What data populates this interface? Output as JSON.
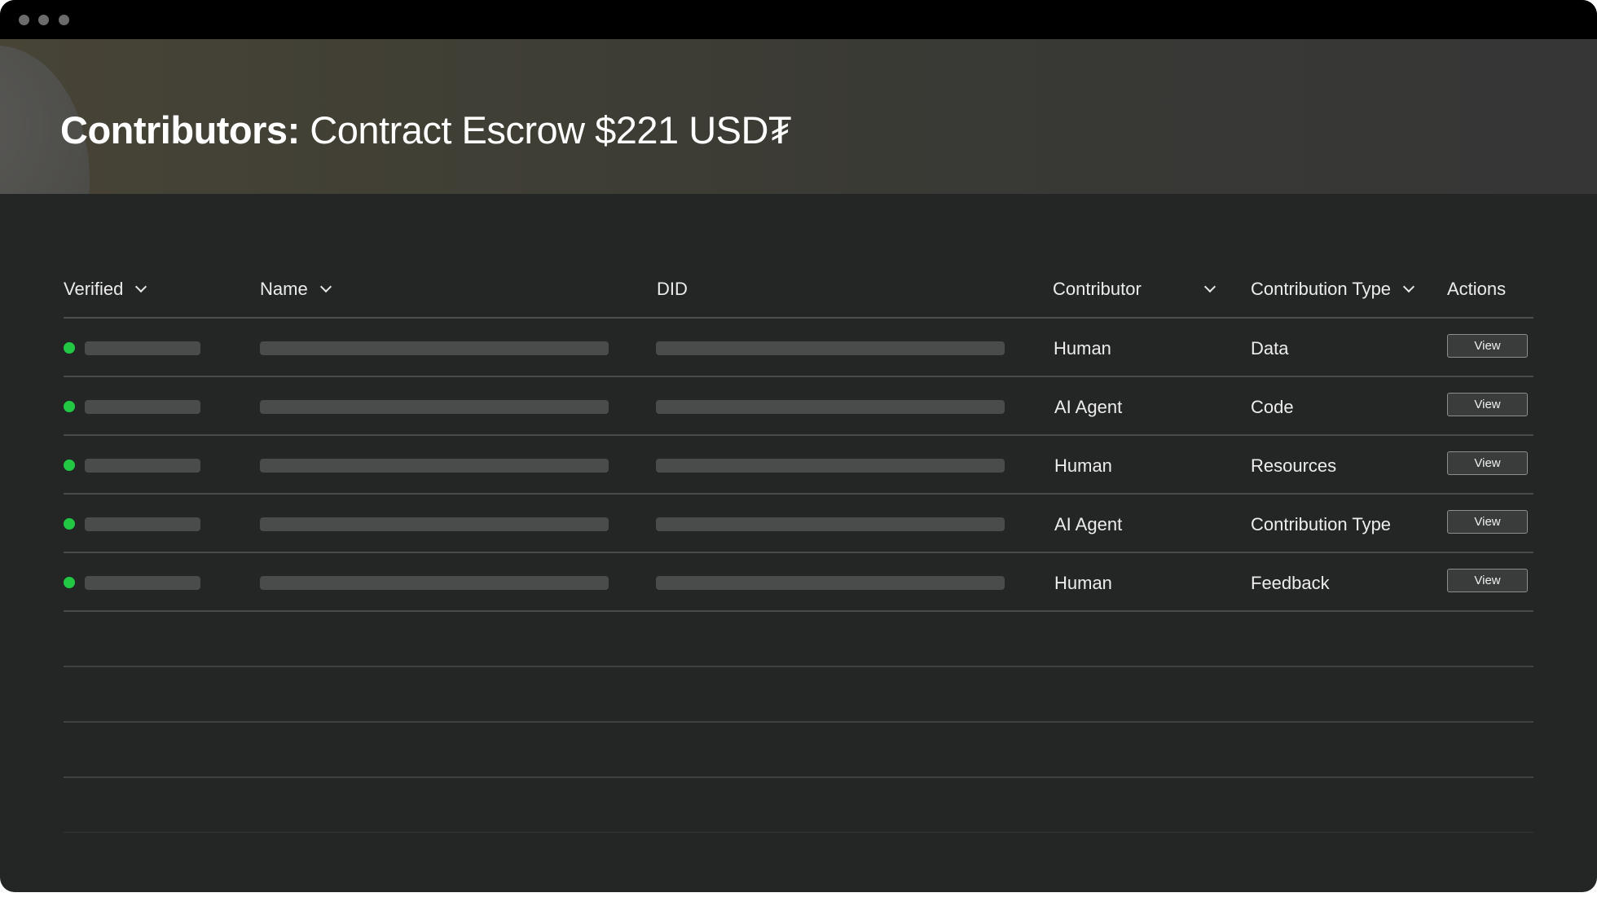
{
  "header": {
    "title_bold": "Contributors:",
    "title_rest": "Contract Escrow $221 USD₮"
  },
  "table": {
    "columns": [
      {
        "label": "Verified",
        "sortable": true
      },
      {
        "label": "Name",
        "sortable": true
      },
      {
        "label": "DID",
        "sortable": false
      },
      {
        "label": "Contributor",
        "sortable": true
      },
      {
        "label": "Contribution Type",
        "sortable": true
      },
      {
        "label": "Actions",
        "sortable": false
      }
    ],
    "rows": [
      {
        "verified": true,
        "contributor": "Human",
        "contribution_type": "Data",
        "action": "View"
      },
      {
        "verified": true,
        "contributor": "AI Agent",
        "contribution_type": "Code",
        "action": "View"
      },
      {
        "verified": true,
        "contributor": "Human",
        "contribution_type": "Resources",
        "action": "View"
      },
      {
        "verified": true,
        "contributor": "AI Agent",
        "contribution_type": "Contribution Type",
        "action": "View"
      },
      {
        "verified": true,
        "contributor": "Human",
        "contribution_type": "Feedback",
        "action": "View"
      }
    ]
  },
  "colors": {
    "background": "#242625",
    "verified_dot": "#22c743",
    "placeholder_bar": "#4a4c4c",
    "titlebar": "#000000"
  }
}
